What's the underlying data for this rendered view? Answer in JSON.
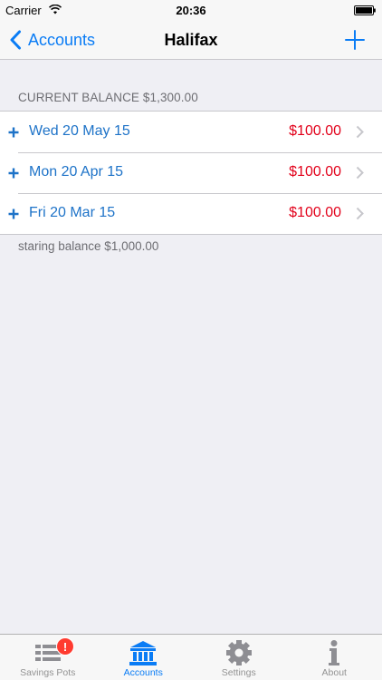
{
  "status_bar": {
    "carrier": "Carrier",
    "time": "20:36"
  },
  "nav": {
    "back_label": "Accounts",
    "title": "Halifax"
  },
  "balance_header": "CURRENT BALANCE $1,300.00",
  "entries": [
    {
      "date": "Wed 20 May 15",
      "amount": "$100.00"
    },
    {
      "date": "Mon 20 Apr 15",
      "amount": "$100.00"
    },
    {
      "date": "Fri 20 Mar 15",
      "amount": "$100.00"
    }
  ],
  "starting_balance": "staring balance $1,000.00",
  "tabs": [
    {
      "label": "Savings Pots",
      "icon": "list-icon",
      "badge": "!"
    },
    {
      "label": "Accounts",
      "icon": "bank-icon",
      "active": true
    },
    {
      "label": "Settings",
      "icon": "gear-icon"
    },
    {
      "label": "About",
      "icon": "info-icon"
    }
  ],
  "colors": {
    "accent": "#0a7cf5",
    "amount": "#e2001a",
    "date": "#1e73c8",
    "background": "#efeff4"
  }
}
